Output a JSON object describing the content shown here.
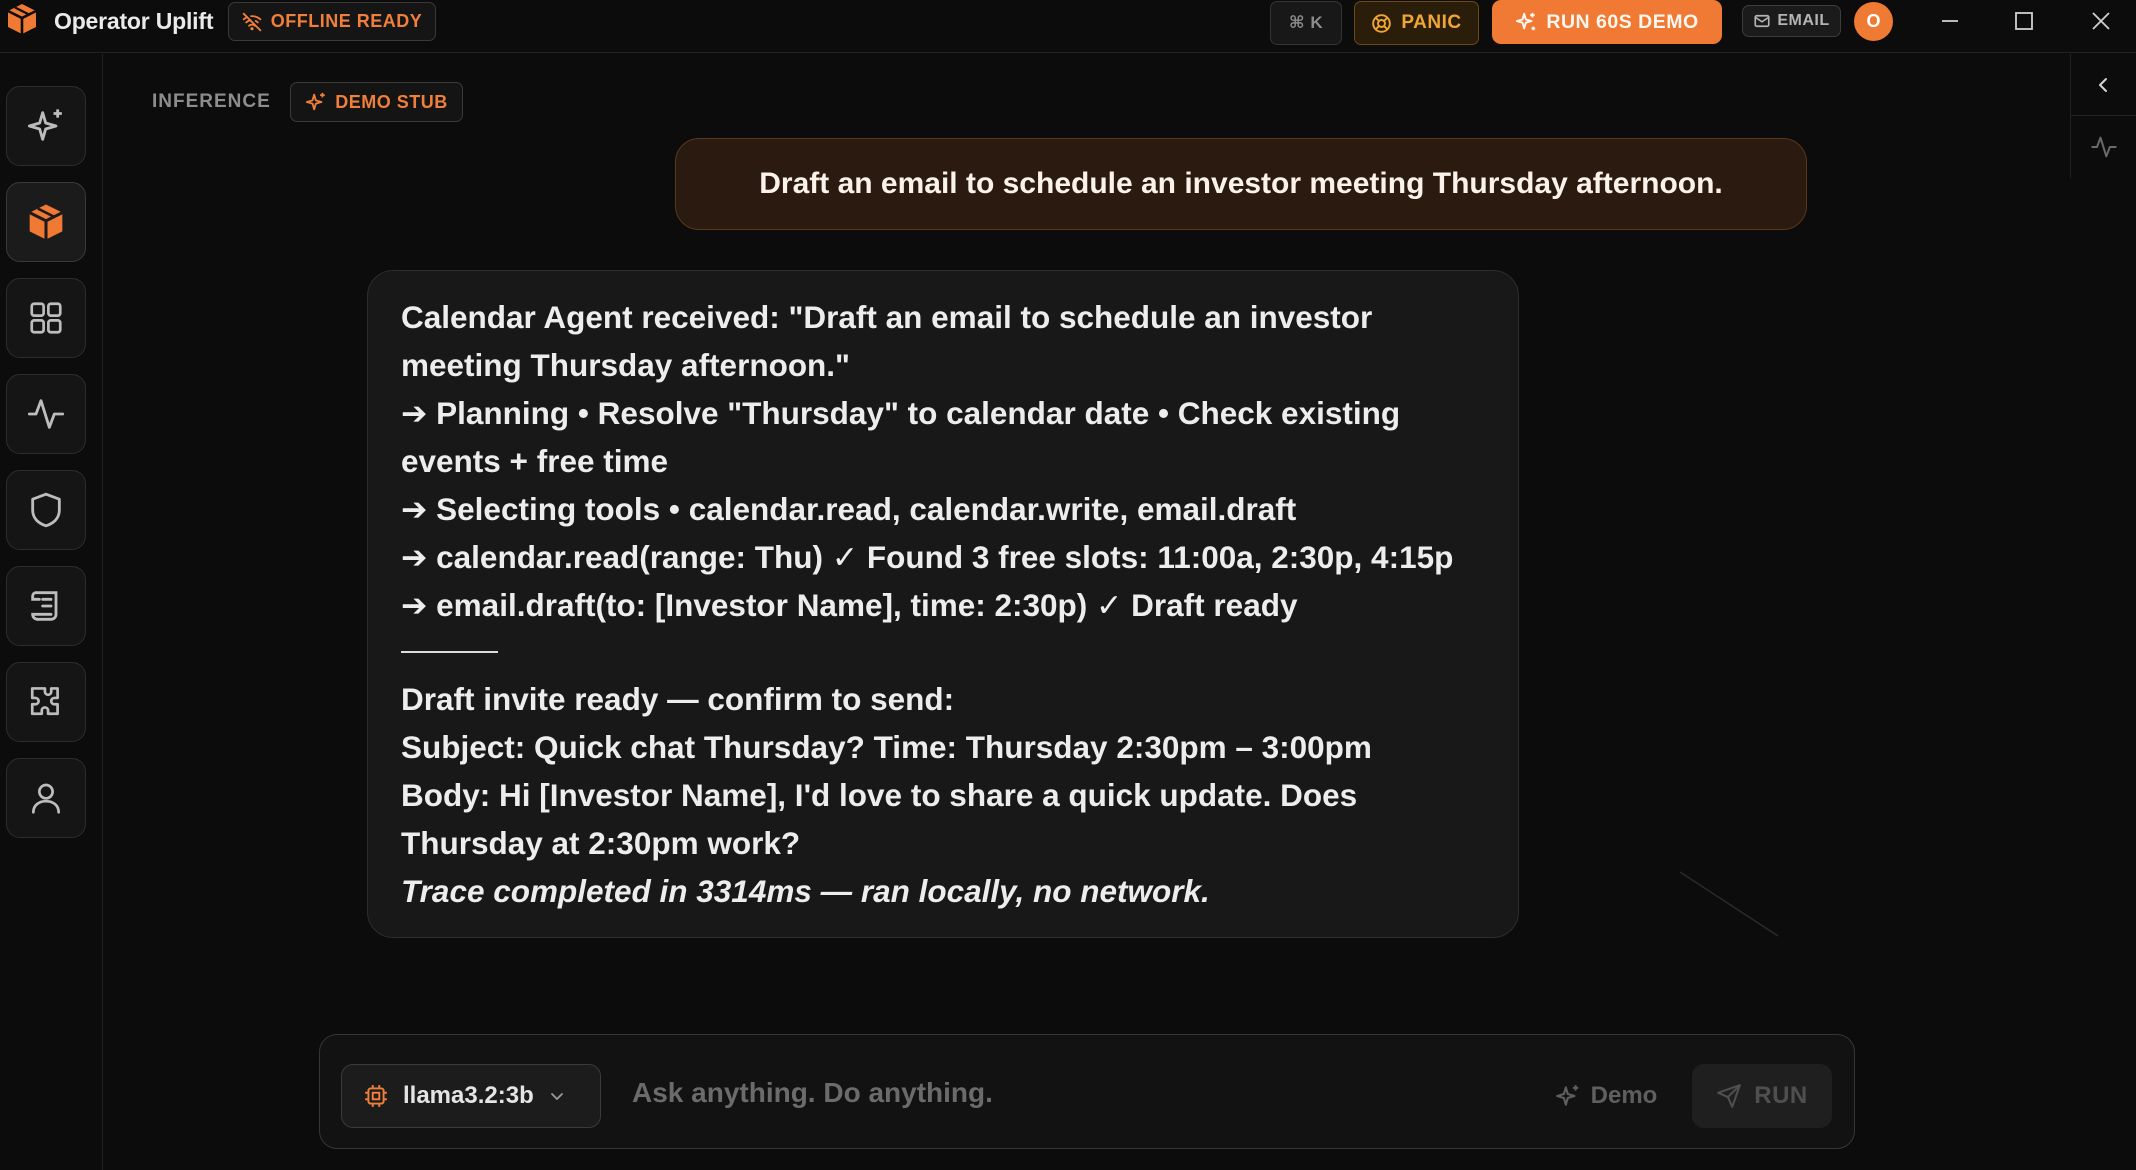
{
  "titlebar": {
    "app_name": "Operator Uplift",
    "offline_label": "OFFLINE READY",
    "cmdk_label": "⌘ K",
    "panic_label": "PANIC",
    "demo_label": "RUN 60S DEMO",
    "email_label": "EMAIL",
    "avatar_initial": "O"
  },
  "rail": {
    "items": [
      {
        "name": "sparkles"
      },
      {
        "name": "box",
        "active": true
      },
      {
        "name": "grid"
      },
      {
        "name": "activity"
      },
      {
        "name": "shield"
      },
      {
        "name": "scroll"
      },
      {
        "name": "puzzle"
      },
      {
        "name": "user"
      }
    ]
  },
  "header": {
    "inference_label": "INFERENCE",
    "stub_label": "DEMO STUB"
  },
  "conversation": {
    "user_message": "Draft an email to schedule an investor meeting Thursday afternoon.",
    "agent_lines": [
      "Calendar Agent received: \"Draft an email to schedule an investor meeting Thursday afternoon.\"",
      "➔ Planning • Resolve \"Thursday\" to calendar date • Check existing events + free time",
      "➔ Selecting tools • calendar.read, calendar.write, email.draft",
      "➔ calendar.read(range: Thu) ✓ Found 3 free slots: 11:00a, 2:30p, 4:15p ➔ email.draft(to: [Investor Name], time: 2:30p) ✓ Draft ready"
    ],
    "draft_lines": [
      "Draft invite ready — confirm to send:",
      "Subject: Quick chat Thursday? Time: Thursday 2:30pm – 3:00pm",
      "Body: Hi [Investor Name], I'd love to share a quick update. Does Thursday at 2:30pm work?"
    ],
    "trace_line": "Trace completed in 3314ms — ran locally, no network."
  },
  "composer": {
    "model": "llama3.2:3b",
    "placeholder": "Ask anything. Do anything.",
    "demo_label": "Demo",
    "run_label": "RUN"
  },
  "colors": {
    "accent": "#f07a33",
    "panic": "#f0a535",
    "background": "#0c0c0c",
    "bubble_user": "#2a1a10",
    "bubble_agent": "#181818"
  }
}
